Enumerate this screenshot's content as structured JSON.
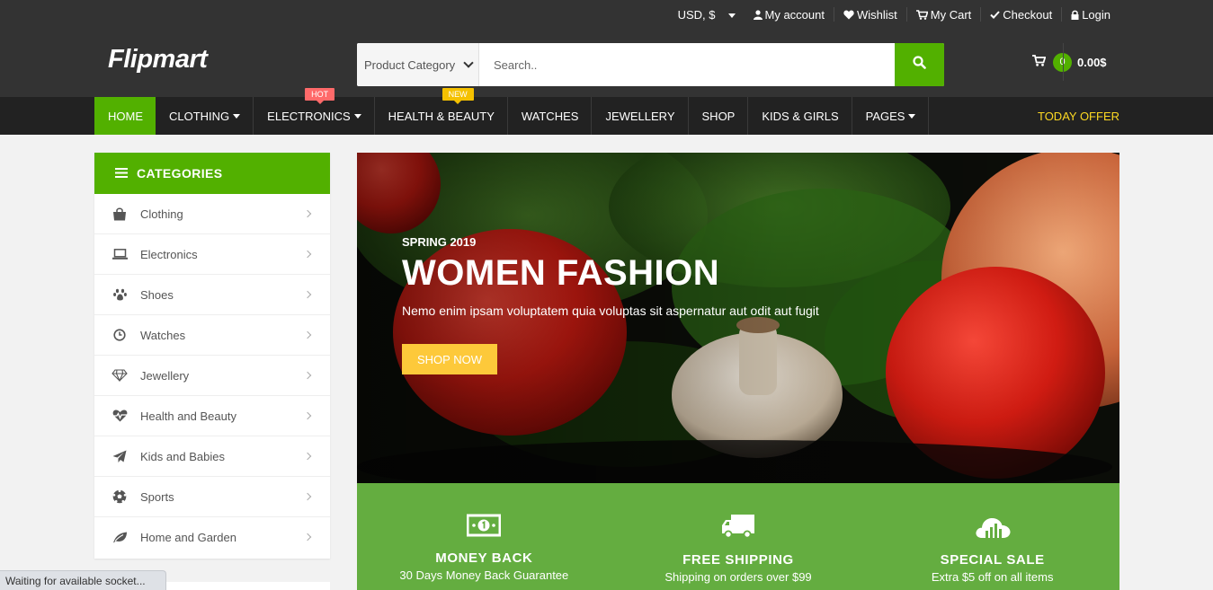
{
  "topbar": {
    "currency": "USD, $",
    "links": [
      {
        "label": "My account",
        "icon": "user-icon"
      },
      {
        "label": "Wishlist",
        "icon": "heart-icon"
      },
      {
        "label": "My Cart",
        "icon": "cart-icon"
      },
      {
        "label": "Checkout",
        "icon": "check-icon"
      },
      {
        "label": "Login",
        "icon": "lock-icon"
      }
    ]
  },
  "header": {
    "logo": "Flipmart",
    "search": {
      "category": "Product Category",
      "placeholder": "Search.."
    },
    "cart": {
      "count": "0",
      "total": "0.00$"
    }
  },
  "nav": {
    "items": [
      {
        "label": "HOME",
        "active": true
      },
      {
        "label": "CLOTHING",
        "dropdown": true
      },
      {
        "label": "ELECTRONICS",
        "dropdown": true,
        "tag": "HOT"
      },
      {
        "label": "HEALTH & BEAUTY",
        "tag": "NEW"
      },
      {
        "label": "WATCHES"
      },
      {
        "label": "JEWELLERY"
      },
      {
        "label": "SHOP"
      },
      {
        "label": "KIDS & GIRLS"
      },
      {
        "label": "PAGES",
        "dropdown": true
      }
    ],
    "offer": "TODAY OFFER"
  },
  "categories": {
    "title": "CATEGORIES",
    "items": [
      {
        "label": "Clothing",
        "icon": "shopping-bag-icon"
      },
      {
        "label": "Electronics",
        "icon": "laptop-icon"
      },
      {
        "label": "Shoes",
        "icon": "paw-icon"
      },
      {
        "label": "Watches",
        "icon": "clock-icon"
      },
      {
        "label": "Jewellery",
        "icon": "diamond-icon"
      },
      {
        "label": "Health and Beauty",
        "icon": "heartbeat-icon"
      },
      {
        "label": "Kids and Babies",
        "icon": "paper-plane-icon"
      },
      {
        "label": "Sports",
        "icon": "soccer-ball-icon"
      },
      {
        "label": "Home and Garden",
        "icon": "leaf-icon"
      }
    ]
  },
  "hero": {
    "kicker": "SPRING 2019",
    "title": "WOMEN FASHION",
    "description": "Nemo enim ipsam voluptatem quia voluptas sit aspernatur aut odit aut fugit",
    "button": "SHOP NOW"
  },
  "info": [
    {
      "title": "MONEY BACK",
      "subtitle": "30 Days Money Back Guarantee",
      "icon": "money-icon"
    },
    {
      "title": "FREE SHIPPING",
      "subtitle": "Shipping on orders over $99",
      "icon": "truck-icon"
    },
    {
      "title": "SPECIAL SALE",
      "subtitle": "Extra $5 off on all items",
      "icon": "cloud-chart-icon"
    }
  ],
  "status": "Waiting for available socket...",
  "colors": {
    "accent": "#52b000",
    "dark": "#333333",
    "nav": "#222222",
    "offer": "#fdd922",
    "button": "#fdc93a",
    "strip": "#64ad40"
  }
}
